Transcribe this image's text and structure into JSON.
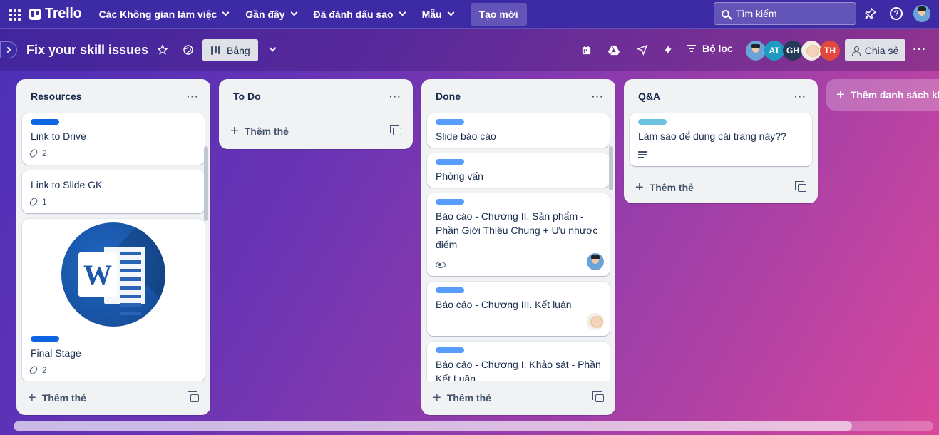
{
  "topnav": {
    "logo": "Trello",
    "menus": [
      {
        "label": "Các Không gian làm việc"
      },
      {
        "label": "Gần đây"
      },
      {
        "label": "Đã đánh dấu sao"
      },
      {
        "label": "Mẫu"
      }
    ],
    "create_label": "Tạo mới",
    "search_placeholder": "Tìm kiếm"
  },
  "board": {
    "title": "Fix your skill issues",
    "view_label": "Bảng",
    "filter_label": "Bộ lọc",
    "share_label": "Chia sẻ",
    "members": [
      "AT",
      "GH",
      "TH"
    ]
  },
  "lists": [
    {
      "title": "Resources",
      "add_label": "Thêm thẻ",
      "cards": [
        {
          "label_color": "#0c66e4",
          "title": "Link to Drive",
          "attachments": "2"
        },
        {
          "title": "Link to Slide GK",
          "attachments": "1"
        },
        {
          "label_color": "#0c66e4",
          "title": "Final Stage",
          "attachments": "2"
        }
      ]
    },
    {
      "title": "To Do",
      "add_label": "Thêm thẻ",
      "cards": []
    },
    {
      "title": "Done",
      "add_label": "Thêm thẻ",
      "cards": [
        {
          "label_color": "#579dff",
          "title": "Slide báo cáo"
        },
        {
          "label_color": "#579dff",
          "title": "Phỏng vấn"
        },
        {
          "label_color": "#579dff",
          "title": "Báo cáo - Chương II. Sản phẩm - Phần Giới Thiệu Chung + Ưu nhược điểm"
        },
        {
          "label_color": "#579dff",
          "title": "Báo cáo - Chương III. Kết luận"
        },
        {
          "label_color": "#579dff",
          "title": "Báo cáo - Chương I. Khảo sát - Phần Kết Luận"
        }
      ]
    },
    {
      "title": "Q&A",
      "add_label": "Thêm thẻ",
      "cards": [
        {
          "label_color": "#6cc3e0",
          "title": "Làm sao để dùng cái trang này??"
        }
      ]
    }
  ],
  "add_list_label": "Thêm danh sách khác",
  "colors": {
    "member_at": "#1d9bc0",
    "member_gh": "#253858",
    "member_th": "#e2483d"
  }
}
